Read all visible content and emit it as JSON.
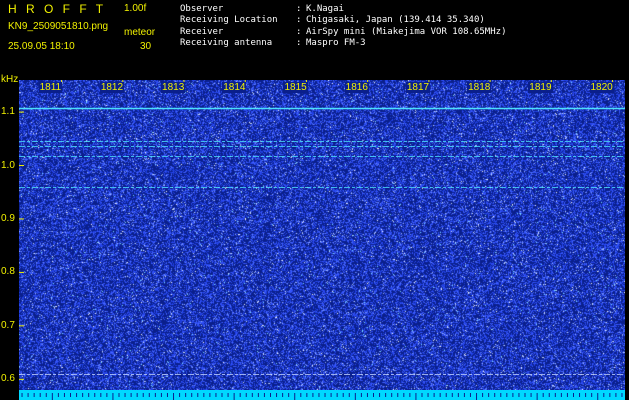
{
  "header": {
    "brand": "H R O F F T",
    "version": "1.00f",
    "filename": "KN9_2509051810.png",
    "mode_label": "meteor",
    "timestamp": "25.09.05 18:10",
    "mode_value": "30"
  },
  "info": {
    "rows": [
      {
        "key": "Observer",
        "sep": ":",
        "value": "K.Nagai"
      },
      {
        "key": "Receiving Location",
        "sep": ":",
        "value": "Chigasaki, Japan (139.414 35.340)"
      },
      {
        "key": "Receiver",
        "sep": ":",
        "value": "AirSpy mini (Miakejima VOR 108.65MHz)"
      },
      {
        "key": "Receiving antenna",
        "sep": ":",
        "value": "Maspro FM-3"
      }
    ]
  },
  "chart_data": {
    "type": "heatmap",
    "ylabel": "kHz",
    "y_ticks": [
      "1.1",
      "1.0",
      "0.9",
      "0.8",
      "0.7",
      "0.6"
    ],
    "x_ticks": [
      "1811",
      "1812",
      "1813",
      "1814",
      "1815",
      "1816",
      "1817",
      "1818",
      "1819",
      "1820"
    ],
    "ylim": [
      0.58,
      1.16
    ],
    "xlim": [
      1810.5,
      1820.4
    ],
    "persistent_lines_khz": [
      1.108,
      1.045,
      1.036,
      1.018,
      0.96,
      0.61
    ],
    "colors": {
      "background": "#0a1f8c",
      "noise": "#3b5cff",
      "line": "#4fe8ff",
      "baseline": "#00d8ff",
      "label": "#f2f200"
    }
  }
}
